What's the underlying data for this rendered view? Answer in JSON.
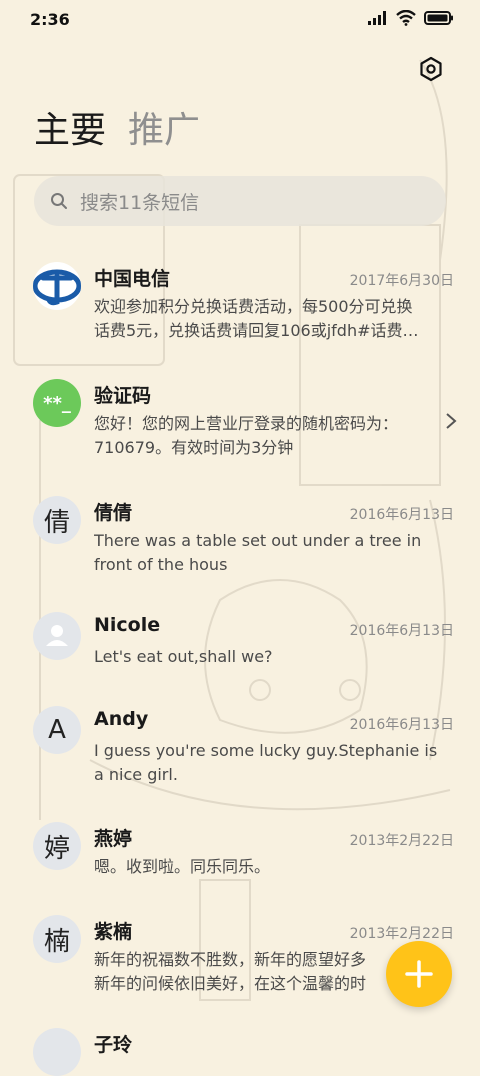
{
  "status_bar": {
    "time": "2:36",
    "icons": [
      "signal-icon",
      "wifi-icon",
      "battery-icon"
    ]
  },
  "header": {
    "tabs": [
      {
        "label": "主要",
        "active": true
      },
      {
        "label": "推广",
        "active": false
      }
    ],
    "settings_icon": "gear-icon"
  },
  "search": {
    "placeholder": "搜索11条短信"
  },
  "messages": [
    {
      "name": "中国电信",
      "date": "2017年6月30日",
      "avatar_text": "",
      "avatar_type": "logo-telecom",
      "line1": "欢迎参加积分兑换话费活动，每500分可兑换",
      "line2": "话费5元，兑换话费请回复106或jfdh#话费…"
    },
    {
      "name": "验证码",
      "date": "",
      "avatar_text": "**_",
      "avatar_type": "code",
      "line1": "您好！您的网上营业厅登录的随机密码为：",
      "line2": "710679。有效时间为3分钟"
    },
    {
      "name": "倩倩",
      "date": "2016年6月13日",
      "avatar_text": "倩",
      "avatar_type": "letter",
      "line1": "There was a table set out under a tree in",
      "line2": "front of the hous"
    },
    {
      "name": "Nicole",
      "date": "2016年6月13日",
      "avatar_text": "",
      "avatar_type": "person",
      "line1": "Let's eat out,shall we?",
      "line2": ""
    },
    {
      "name": "Andy",
      "date": "2016年6月13日",
      "avatar_text": "A",
      "avatar_type": "letter",
      "line1": "I guess you're some lucky guy.Stephanie is",
      "line2": "a nice girl."
    },
    {
      "name": "燕婷",
      "date": "2013年2月22日",
      "avatar_text": "婷",
      "avatar_type": "letter",
      "line1": "嗯。收到啦。同乐同乐。",
      "line2": ""
    },
    {
      "name": "紫楠",
      "date": "2013年2月22日",
      "avatar_text": "楠",
      "avatar_type": "letter",
      "line1": "新年的祝福数不胜数，新年的愿望好多",
      "line2": "新年的问候依旧美好，在这个温馨的时"
    },
    {
      "name": "子玲",
      "date": "",
      "avatar_text": "",
      "avatar_type": "letter",
      "line1": "",
      "line2": ""
    }
  ],
  "colors": {
    "background": "#f8f1e0",
    "fab": "#ffc318",
    "code_avatar": "#6cc95a",
    "telecom_blue": "#1a5ba8"
  },
  "fab": {
    "icon": "plus-icon"
  }
}
